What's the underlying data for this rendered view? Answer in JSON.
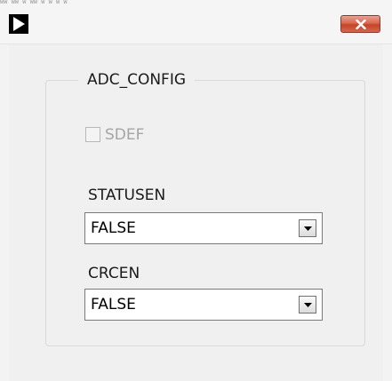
{
  "window": {
    "title_strip": "WW WW W WW W W W W",
    "close_glyph": "close-icon"
  },
  "group": {
    "title": "ADC_CONFIG"
  },
  "sdef": {
    "label": "SDEF",
    "checked": false,
    "enabled": false
  },
  "statusen": {
    "label": "STATUSEN",
    "value": "FALSE"
  },
  "crcen": {
    "label": "CRCEN",
    "value": "FALSE"
  },
  "colors": {
    "close_button": "#d9694f",
    "disabled_text": "#a5a5a5",
    "window_bg": "#f0f0f0"
  }
}
